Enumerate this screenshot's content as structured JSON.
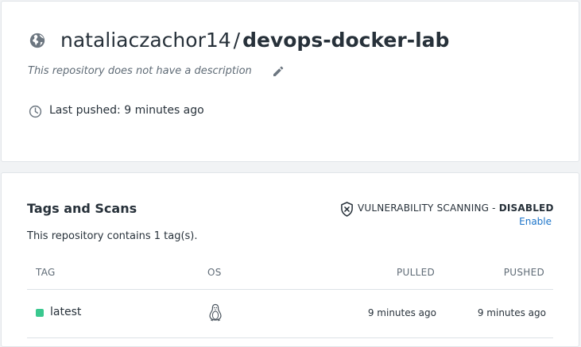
{
  "repo": {
    "namespace": "nataliaczachor14",
    "separator": "/",
    "name": "devops-docker-lab",
    "description": "This repository does not have a description",
    "last_pushed": "Last pushed: 9 minutes ago",
    "visibility_icon": "globe-icon"
  },
  "tags_section": {
    "title": "Tags and Scans",
    "scanning_label": "VULNERABILITY SCANNING - ",
    "scanning_status": "DISABLED",
    "enable_label": "Enable",
    "tag_count_text": "This repository contains 1 tag(s).",
    "columns": [
      "TAG",
      "OS",
      "PULLED",
      "PUSHED"
    ],
    "rows": [
      {
        "tag": "latest",
        "os": "linux-icon",
        "pulled": "9 minutes ago",
        "pushed": "9 minutes ago",
        "status_color": "#3ac88f"
      }
    ]
  },
  "colors": {
    "link": "#1a73c9",
    "status_active": "#3ac88f",
    "text_muted": "#5f6b76"
  }
}
